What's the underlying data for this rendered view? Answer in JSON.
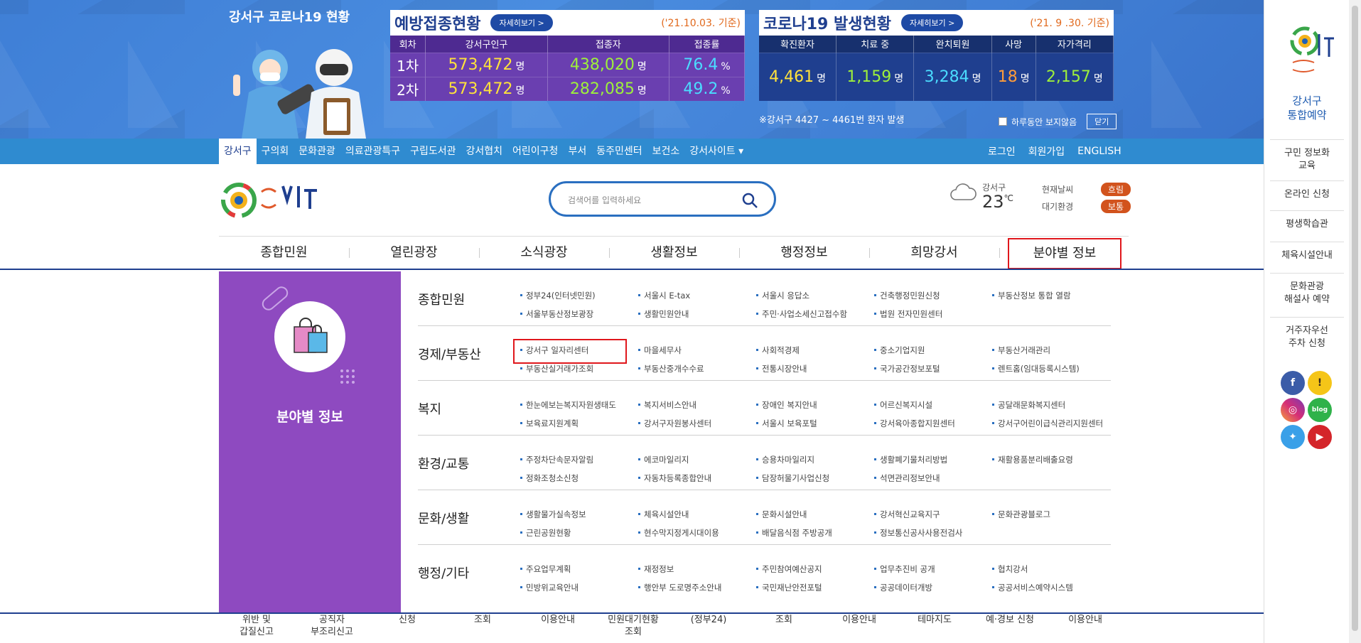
{
  "banner": {
    "title": "강서구 코로나19 현황",
    "vaccination": {
      "title": "예방접종현황",
      "more": "자세히보기 >",
      "date": "('21.10.03. 기준)",
      "headers": [
        "회차",
        "강서구인구",
        "접종자",
        "접종률"
      ],
      "rows": [
        {
          "round": "1차",
          "population": "573,472",
          "vaccinated": "438,020",
          "rate": "76.4"
        },
        {
          "round": "2차",
          "population": "573,472",
          "vaccinated": "282,085",
          "rate": "49.2"
        }
      ],
      "unit_person": "명",
      "unit_percent": "%"
    },
    "covid": {
      "title": "코로나19 발생현황",
      "more": "자세히보기 >",
      "date": "('21. 9 .30. 기준)",
      "headers": [
        "확진환자",
        "치료 중",
        "완치퇴원",
        "사망",
        "자가격리"
      ],
      "values": [
        "4,461",
        "1,159",
        "3,284",
        "18",
        "2,157"
      ],
      "unit": "명",
      "note": "※강서구 4427 ~ 4461번 환자 발생"
    },
    "dismiss_label": "하루동안 보지않음",
    "close_label": "닫기"
  },
  "gnb": {
    "left": [
      "강서구",
      "구의회",
      "문화관광",
      "의료관광특구",
      "구립도서관",
      "강서협치",
      "어린이구청",
      "부서",
      "동주민센터",
      "보건소",
      "강서사이트 ▾"
    ],
    "right": [
      "로그인",
      "회원가입",
      "ENGLISH"
    ]
  },
  "search": {
    "placeholder": "검색어를 입력하세요"
  },
  "weather": {
    "area": "강서구",
    "temp": "23",
    "unit": "℃"
  },
  "air": [
    {
      "label": "현재날씨",
      "value": "흐림"
    },
    {
      "label": "대기환경",
      "value": "보통"
    }
  ],
  "mainnav": [
    "종합민원",
    "열린광장",
    "소식광장",
    "생활정보",
    "행정정보",
    "희망강서",
    "분야별 정보"
  ],
  "mega": {
    "side_title": "분야별 정보",
    "categories": [
      {
        "title": "종합민원",
        "links": [
          "정부24(인터넷민원)",
          "서울시 E-tax",
          "서울시 응답소",
          "건축행정민원신청",
          "부동산정보 통합 열람",
          "서울부동산정보광장",
          "생활민원안내",
          "주민·사업소세신고접수함",
          "법원 전자민원센터"
        ]
      },
      {
        "title": "경제/부동산",
        "links": [
          "강서구 일자리센터",
          "마을세무사",
          "사회적경제",
          "중소기업지원",
          "부동산거래관리",
          "부동산실거래가조회",
          "부동산중개수수료",
          "전통시장안내",
          "국가공간정보포털",
          "렌트홈(임대등록시스템)"
        ]
      },
      {
        "title": "복지",
        "links": [
          "한눈에보는복지자원생태도",
          "복지서비스안내",
          "장애인 복지안내",
          "어르신복지시설",
          "공달래문화복지센터",
          "보육료지원계획",
          "강서구자원봉사센터",
          "서울시 보육포털",
          "강서육아종합지원센터",
          "강서구어린이급식관리지원센터"
        ]
      },
      {
        "title": "환경/교통",
        "links": [
          "주정차단속문자알림",
          "에코마일리지",
          "승용차마일리지",
          "생활폐기물처리방법",
          "재활용품분리배출요령",
          "정화조청소신청",
          "자동차등록종합안내",
          "담장허물기사업신청",
          "석면관리정보안내"
        ]
      },
      {
        "title": "문화/생활",
        "links": [
          "생활물가실속정보",
          "체육시설안내",
          "문화시설안내",
          "강서혁신교육지구",
          "문화관광블로그",
          "근린공원현황",
          "현수막지정게시대이용",
          "배달음식점 주방공개",
          "정보통신공사사용전검사"
        ]
      },
      {
        "title": "행정/기타",
        "links": [
          "주요업무계획",
          "재정정보",
          "주민참여예산공지",
          "업무추진비 공개",
          "협치강서",
          "민방위교육안내",
          "행안부 도로명주소안내",
          "국민재난안전포털",
          "공공데이터개방",
          "공공서비스예약시스템"
        ]
      }
    ]
  },
  "footstrip": [
    "위반 및\n갑질신고",
    "공직자\n부조리신고",
    "신청",
    "조회",
    "이용안내",
    "민원대기현황\n조회",
    "(정부24)",
    "조회",
    "이용안내",
    "테마지도",
    "예·경보 신청",
    "이용안내"
  ],
  "quick": {
    "reserve": [
      "강서구",
      "통합예약"
    ],
    "items": [
      "구민 정보화\n교육",
      "온라인 신청",
      "평생학습관",
      "체육시설안내",
      "문화관광\n해설사 예약",
      "거주자우선\n주차 신청"
    ]
  },
  "colors": {
    "primary": "#1f3f8f",
    "gnb": "#2f8bd0",
    "mega_side": "#8e4ac0",
    "highlight": "#e0171c",
    "badge": "#d2531d"
  }
}
